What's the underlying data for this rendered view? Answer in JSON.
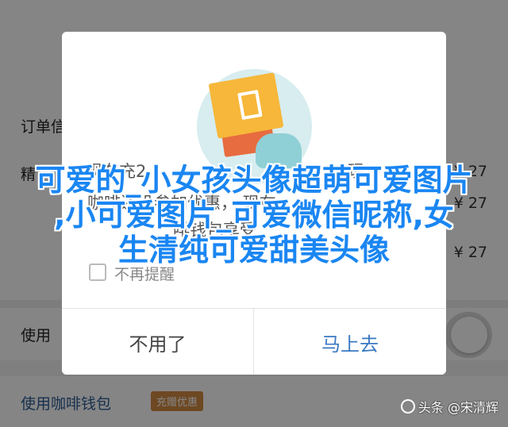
{
  "background": {
    "order_label": "订单信",
    "row1_left": "精",
    "row1_right": "¥ 27",
    "row2_right": "¥ 27",
    "row3_right": "¥ 27",
    "use_label": "使用",
    "coffee_wallet": "使用咖啡钱包",
    "promo_badge": "充赠优惠"
  },
  "dialog": {
    "line1": "现在充2",
    "line1_right": "现",
    "line2": "咖啡还没参加优惠，  现在",
    "line3": "啡钱包享受",
    "line3_right": "咖",
    "checkbox_label": "不再提醒",
    "cancel_label": "不用了",
    "confirm_label": "马上去"
  },
  "caption": {
    "line1": "可爱的_小女孩头像超萌可爱图片",
    "line2": ",小可爱图片_可爱微信昵称,女",
    "line3": "生清纯可爱甜美头像"
  },
  "watermark": {
    "text": "头条 @宋清辉"
  },
  "colors": {
    "accent": "#3a78c3",
    "caption": "#1a86f2",
    "badge": "#d48a42"
  }
}
